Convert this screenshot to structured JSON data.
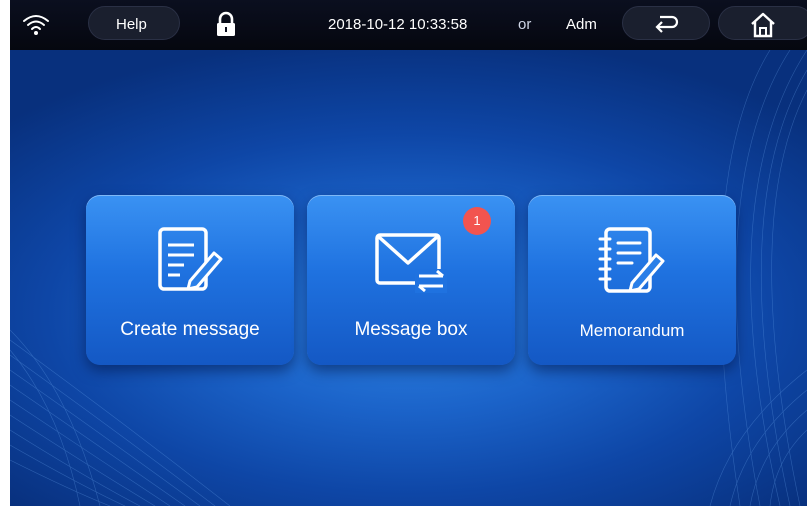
{
  "status_bar": {
    "help_label": "Help",
    "datetime": "2018-10-12 10:33:58",
    "partial_text": "or",
    "user_label": "Adm",
    "icons": [
      "wifi-icon",
      "lock-icon",
      "back-icon",
      "home-icon"
    ]
  },
  "tiles": [
    {
      "label": "Create message",
      "icon": "edit-document-icon"
    },
    {
      "label": "Message box",
      "icon": "mail-icon",
      "badge": "1"
    },
    {
      "label": "Memorandum",
      "icon": "notebook-icon"
    }
  ],
  "colors": {
    "status_bar_bg": "#05070f",
    "screen_bg": "#1b63c9",
    "tile_bg": "#1f72e0",
    "badge_bg": "#f2544f",
    "text": "#ffffff"
  }
}
